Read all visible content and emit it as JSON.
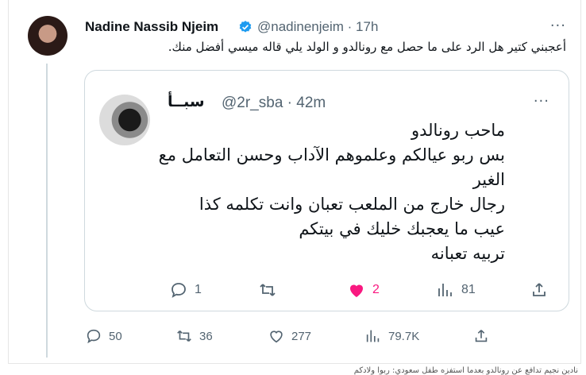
{
  "tweet": {
    "author_name": "Nadine Nassib Njeim",
    "handle_time": "@nadinenjeim · 17h",
    "more_label": "···",
    "text": "أعجبني كتير هل الرد على ما حصل مع رونالدو و الولد يلي قاله ميسي أفضل منك.",
    "actions": {
      "replies": "50",
      "retweets": "36",
      "likes": "277",
      "views": "79.7K"
    }
  },
  "quoted_tweet": {
    "author_name": "سبــأ",
    "handle_time": "@2r_sba · 42m",
    "more_label": "···",
    "lines": [
      "ماحب رونالدو",
      "بس ربو عيالكم وعلموهم الآداب وحسن التعامل مع",
      "الغير",
      "رجال خارج من الملعب تعبان وانت تكلمه كذا",
      "عيب ما يعجبك خليك في بيتكم",
      "تربيه تعبانه"
    ],
    "actions": {
      "replies": "1",
      "likes": "2",
      "views": "81"
    }
  },
  "caption": "نادين نجيم تدافع عن رونالدو بعدما استفزه طفل سعودي: ربوا ولادكم",
  "colors": {
    "like_pink": "#f91880",
    "verified_blue": "#1d9bf0",
    "muted": "#536471"
  }
}
